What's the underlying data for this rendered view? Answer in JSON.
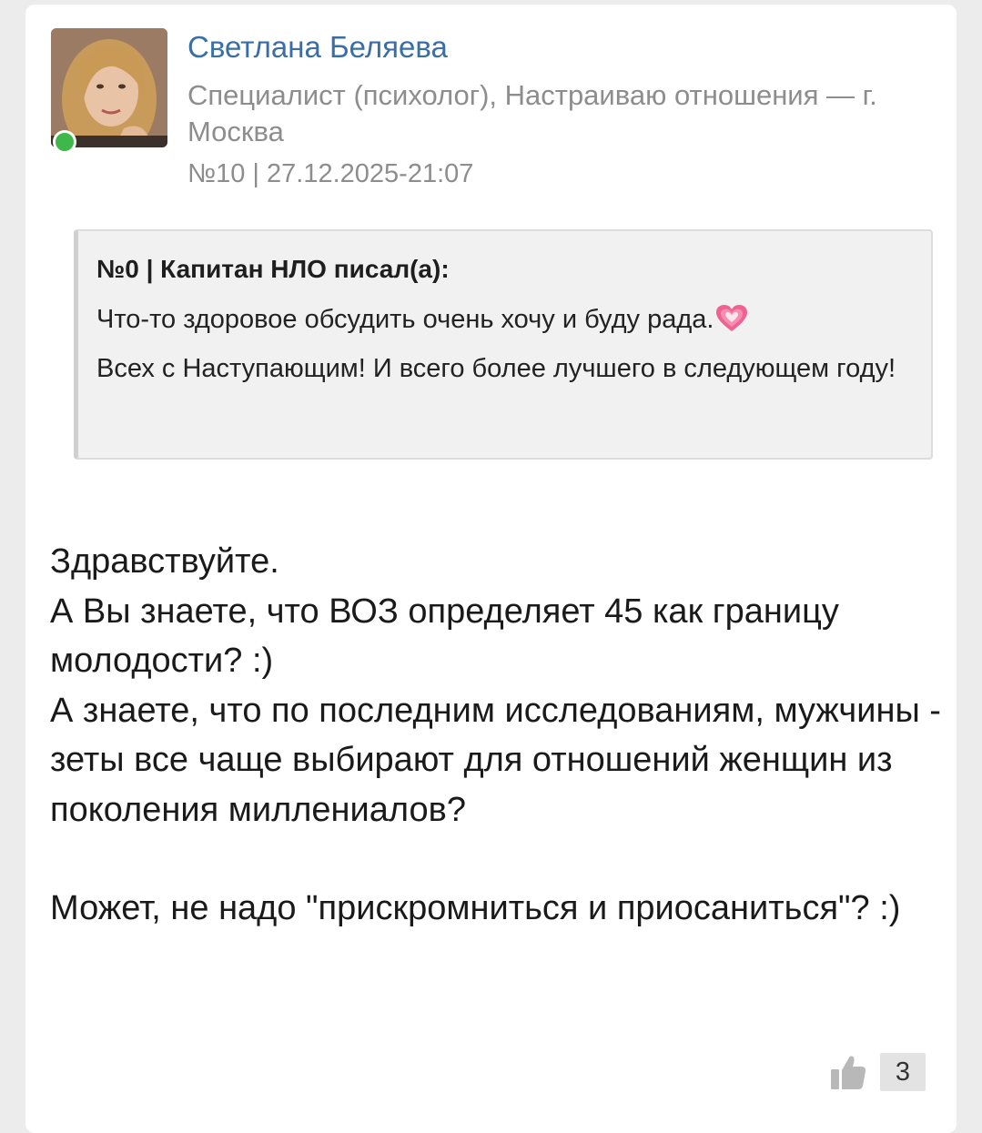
{
  "author": {
    "name": "Светлана Беляева",
    "description": "Специалист (психолог), Настраиваю отношения — г. Москва",
    "online": true
  },
  "post": {
    "meta": "№10 | 27.12.2025-21:07"
  },
  "quote": {
    "header": "№0 | Капитан НЛО писал(а):",
    "text": "Что-то здоровое обсудить очень хочу и буду рада.",
    "text_continued": "Всех с Наступающим! И всего более лучшего в следующем году!",
    "emoji": "heart-icon"
  },
  "body": {
    "paragraph1": "Здравствуйте.",
    "paragraph2": "А Вы знаете, что ВОЗ определяет 45 как границу молодости? :)",
    "paragraph3": "А знаете, что по последним исследованиям, мужчины - зеты все чаще выбирают для отношений женщин из поколения миллениалов?",
    "paragraph4": "Может, не надо \"прискромниться и приосаниться\"? :)"
  },
  "likes": {
    "icon": "thumbs-up-icon",
    "count": "3"
  },
  "colors": {
    "author_name": "#3a6ea5",
    "online_status": "#3fb84a",
    "muted_text": "#8d8d8d",
    "quote_background": "#f1f1f1"
  }
}
